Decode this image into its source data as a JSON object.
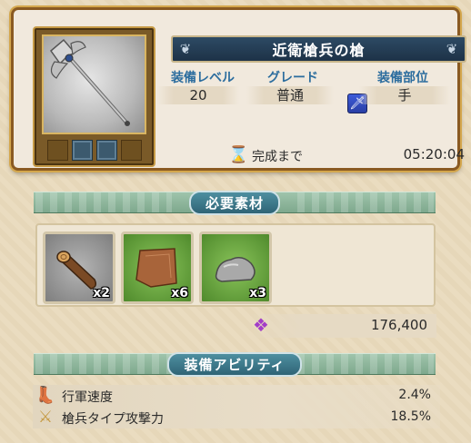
{
  "item": {
    "title": "近衛槍兵の槍",
    "icon": "spear-icon",
    "slots": [
      "gem-slot-icon",
      "gem-slot-icon"
    ]
  },
  "stats": {
    "level": {
      "label": "装備レベル",
      "value": "20"
    },
    "grade": {
      "label": "グレード",
      "value": "普通"
    },
    "part": {
      "label": "装備部位",
      "value": "手",
      "icon": "sword-slot-icon"
    }
  },
  "timer": {
    "label": "完成まで",
    "value": "05:20:04",
    "icon": "hourglass-icon"
  },
  "materials": {
    "header": "必要素材",
    "items": [
      {
        "icon": "log-icon",
        "count": "x2",
        "bg": "#8b8b8b"
      },
      {
        "icon": "leather-icon",
        "count": "x6",
        "bg": "#5f9a3a"
      },
      {
        "icon": "stone-icon",
        "count": "x3",
        "bg": "#5f9a3a"
      }
    ],
    "cost": {
      "icon": "crystal-icon",
      "value": "176,400"
    }
  },
  "abilities": {
    "header": "装備アビリティ",
    "items": [
      {
        "icon": "boot-icon",
        "label": "行軍速度",
        "value": "2.4%"
      },
      {
        "icon": "sword-icon",
        "label": "槍兵タイプ攻撃力",
        "value": "18.5%"
      }
    ]
  }
}
